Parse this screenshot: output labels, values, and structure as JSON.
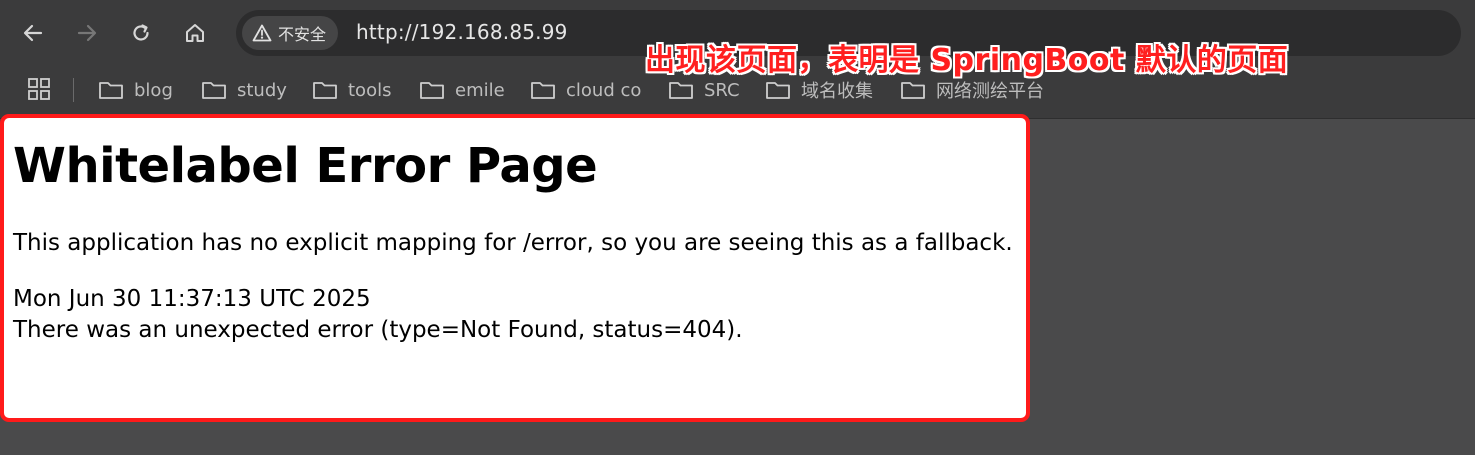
{
  "browser": {
    "security_label": "不安全",
    "url": "http://192.168.85.99"
  },
  "bookmarks": [
    {
      "label": "blog"
    },
    {
      "label": "study"
    },
    {
      "label": "tools"
    },
    {
      "label": "emile"
    },
    {
      "label": "cloud co"
    },
    {
      "label": "SRC"
    },
    {
      "label": "域名收集"
    },
    {
      "label": "网络测绘平台"
    }
  ],
  "annotation": {
    "text": "出现该页面，表明是 SpringBoot 默认的页面",
    "color": "#ff1f1f"
  },
  "page": {
    "title": "Whitelabel Error Page",
    "message": "This application has no explicit mapping for /error, so you are seeing this as a fallback.",
    "timestamp": "Mon Jun 30 11:37:13 UTC 2025",
    "error": "There was an unexpected error (type=Not Found, status=404)."
  },
  "icons": {
    "back": "arrow-left-icon",
    "forward": "arrow-right-icon",
    "reload": "reload-icon",
    "home": "home-icon",
    "warning": "warning-triangle-icon",
    "apps": "apps-grid-icon",
    "folder": "folder-icon"
  },
  "colors": {
    "highlight_border": "#ff1a1a",
    "toolbar_bg": "#3b3b3c",
    "omnibox_bg": "#2c2c2d"
  }
}
